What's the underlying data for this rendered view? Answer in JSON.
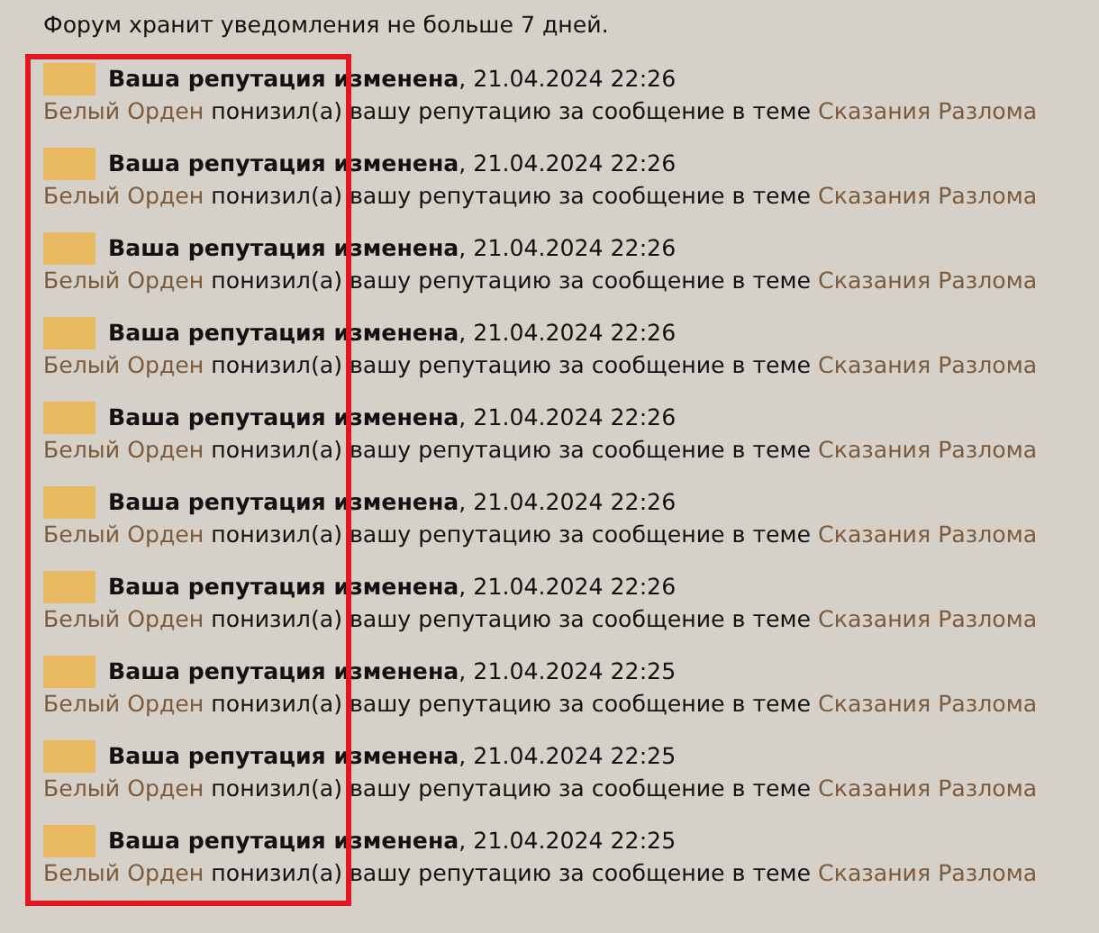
{
  "notice": "Форум хранит уведомления не больше 7 дней.",
  "notifications": [
    {
      "title": "**Ваша репутация изменена**, 21.04.2024 22:26",
      "user": "Белый Орден",
      "action": "понизил(а) вашу репутацию за сообщение в теме",
      "topic": "Сказания Разлома"
    },
    {
      "title": "**Ваша репутация изменена**, 21.04.2024 22:26",
      "user": "Белый Орден",
      "action": "понизил(а) вашу репутацию за сообщение в теме",
      "topic": "Сказания Разлома"
    },
    {
      "title": "**Ваша репутация изменена**, 21.04.2024 22:26",
      "user": "Белый Орден",
      "action": "понизил(а) вашу репутацию за сообщение в теме",
      "topic": "Сказания Разлома"
    },
    {
      "title": "**Ваша репутация изменена**, 21.04.2024 22:26",
      "user": "Белый Орден",
      "action": "понизил(а) вашу репутацию за сообщение в теме",
      "topic": "Сказания Разлома"
    },
    {
      "title": "**Ваша репутация изменена**, 21.04.2024 22:26",
      "user": "Белый Орден",
      "action": "понизил(а) вашу репутацию за сообщение в теме",
      "topic": "Сказания Разлома"
    },
    {
      "title": "**Ваша репутация изменена**, 21.04.2024 22:26",
      "user": "Белый Орден",
      "action": "понизил(а) вашу репутацию за сообщение в теме",
      "topic": "Сказания Разлома"
    },
    {
      "title": "**Ваша репутация изменена**, 21.04.2024 22:26",
      "user": "Белый Орден",
      "action": "понизил(а) вашу репутацию за сообщение в теме",
      "topic": "Сказания Разлома"
    },
    {
      "title": "**Ваша репутация изменена**, 21.04.2024 22:25",
      "user": "Белый Орден",
      "action": "понизил(а) вашу репутацию за сообщение в теме",
      "topic": "Сказания Разлома"
    },
    {
      "title": "**Ваша репутация изменена**, 21.04.2024 22:25",
      "user": "Белый Орден",
      "action": "понизил(а) вашу репутацию за сообщение в теме",
      "topic": "Сказания Разлома"
    },
    {
      "title": "**Ваша репутация изменена**, 21.04.2024 22:25",
      "user": "Белый Орден",
      "action": "понизил(а) вашу репутацию за сообщение в теме",
      "topic": "Сказания Разлома"
    }
  ]
}
